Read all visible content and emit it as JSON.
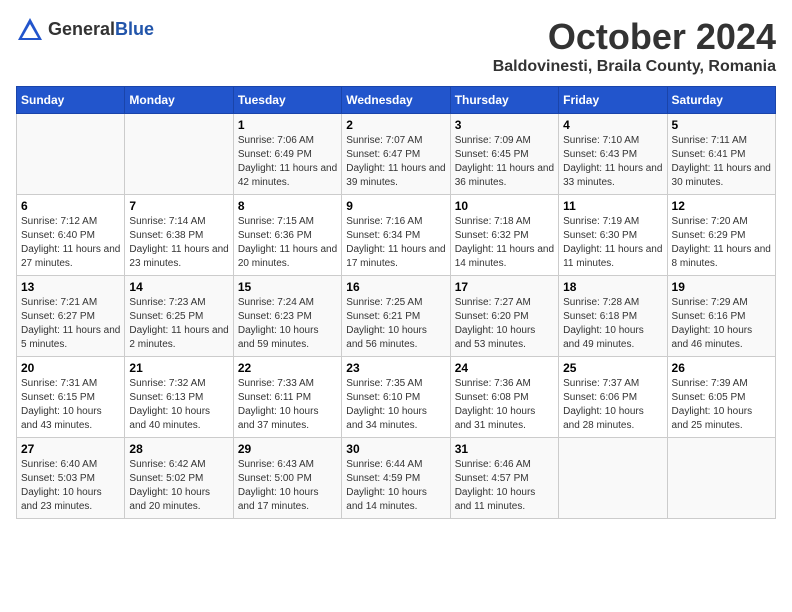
{
  "logo": {
    "general": "General",
    "blue": "Blue"
  },
  "header": {
    "month": "October 2024",
    "location": "Baldovinesti, Braila County, Romania"
  },
  "days_of_week": [
    "Sunday",
    "Monday",
    "Tuesday",
    "Wednesday",
    "Thursday",
    "Friday",
    "Saturday"
  ],
  "weeks": [
    [
      {
        "num": "",
        "info": ""
      },
      {
        "num": "",
        "info": ""
      },
      {
        "num": "1",
        "info": "Sunrise: 7:06 AM\nSunset: 6:49 PM\nDaylight: 11 hours and 42 minutes."
      },
      {
        "num": "2",
        "info": "Sunrise: 7:07 AM\nSunset: 6:47 PM\nDaylight: 11 hours and 39 minutes."
      },
      {
        "num": "3",
        "info": "Sunrise: 7:09 AM\nSunset: 6:45 PM\nDaylight: 11 hours and 36 minutes."
      },
      {
        "num": "4",
        "info": "Sunrise: 7:10 AM\nSunset: 6:43 PM\nDaylight: 11 hours and 33 minutes."
      },
      {
        "num": "5",
        "info": "Sunrise: 7:11 AM\nSunset: 6:41 PM\nDaylight: 11 hours and 30 minutes."
      }
    ],
    [
      {
        "num": "6",
        "info": "Sunrise: 7:12 AM\nSunset: 6:40 PM\nDaylight: 11 hours and 27 minutes."
      },
      {
        "num": "7",
        "info": "Sunrise: 7:14 AM\nSunset: 6:38 PM\nDaylight: 11 hours and 23 minutes."
      },
      {
        "num": "8",
        "info": "Sunrise: 7:15 AM\nSunset: 6:36 PM\nDaylight: 11 hours and 20 minutes."
      },
      {
        "num": "9",
        "info": "Sunrise: 7:16 AM\nSunset: 6:34 PM\nDaylight: 11 hours and 17 minutes."
      },
      {
        "num": "10",
        "info": "Sunrise: 7:18 AM\nSunset: 6:32 PM\nDaylight: 11 hours and 14 minutes."
      },
      {
        "num": "11",
        "info": "Sunrise: 7:19 AM\nSunset: 6:30 PM\nDaylight: 11 hours and 11 minutes."
      },
      {
        "num": "12",
        "info": "Sunrise: 7:20 AM\nSunset: 6:29 PM\nDaylight: 11 hours and 8 minutes."
      }
    ],
    [
      {
        "num": "13",
        "info": "Sunrise: 7:21 AM\nSunset: 6:27 PM\nDaylight: 11 hours and 5 minutes."
      },
      {
        "num": "14",
        "info": "Sunrise: 7:23 AM\nSunset: 6:25 PM\nDaylight: 11 hours and 2 minutes."
      },
      {
        "num": "15",
        "info": "Sunrise: 7:24 AM\nSunset: 6:23 PM\nDaylight: 10 hours and 59 minutes."
      },
      {
        "num": "16",
        "info": "Sunrise: 7:25 AM\nSunset: 6:21 PM\nDaylight: 10 hours and 56 minutes."
      },
      {
        "num": "17",
        "info": "Sunrise: 7:27 AM\nSunset: 6:20 PM\nDaylight: 10 hours and 53 minutes."
      },
      {
        "num": "18",
        "info": "Sunrise: 7:28 AM\nSunset: 6:18 PM\nDaylight: 10 hours and 49 minutes."
      },
      {
        "num": "19",
        "info": "Sunrise: 7:29 AM\nSunset: 6:16 PM\nDaylight: 10 hours and 46 minutes."
      }
    ],
    [
      {
        "num": "20",
        "info": "Sunrise: 7:31 AM\nSunset: 6:15 PM\nDaylight: 10 hours and 43 minutes."
      },
      {
        "num": "21",
        "info": "Sunrise: 7:32 AM\nSunset: 6:13 PM\nDaylight: 10 hours and 40 minutes."
      },
      {
        "num": "22",
        "info": "Sunrise: 7:33 AM\nSunset: 6:11 PM\nDaylight: 10 hours and 37 minutes."
      },
      {
        "num": "23",
        "info": "Sunrise: 7:35 AM\nSunset: 6:10 PM\nDaylight: 10 hours and 34 minutes."
      },
      {
        "num": "24",
        "info": "Sunrise: 7:36 AM\nSunset: 6:08 PM\nDaylight: 10 hours and 31 minutes."
      },
      {
        "num": "25",
        "info": "Sunrise: 7:37 AM\nSunset: 6:06 PM\nDaylight: 10 hours and 28 minutes."
      },
      {
        "num": "26",
        "info": "Sunrise: 7:39 AM\nSunset: 6:05 PM\nDaylight: 10 hours and 25 minutes."
      }
    ],
    [
      {
        "num": "27",
        "info": "Sunrise: 6:40 AM\nSunset: 5:03 PM\nDaylight: 10 hours and 23 minutes."
      },
      {
        "num": "28",
        "info": "Sunrise: 6:42 AM\nSunset: 5:02 PM\nDaylight: 10 hours and 20 minutes."
      },
      {
        "num": "29",
        "info": "Sunrise: 6:43 AM\nSunset: 5:00 PM\nDaylight: 10 hours and 17 minutes."
      },
      {
        "num": "30",
        "info": "Sunrise: 6:44 AM\nSunset: 4:59 PM\nDaylight: 10 hours and 14 minutes."
      },
      {
        "num": "31",
        "info": "Sunrise: 6:46 AM\nSunset: 4:57 PM\nDaylight: 10 hours and 11 minutes."
      },
      {
        "num": "",
        "info": ""
      },
      {
        "num": "",
        "info": ""
      }
    ]
  ]
}
